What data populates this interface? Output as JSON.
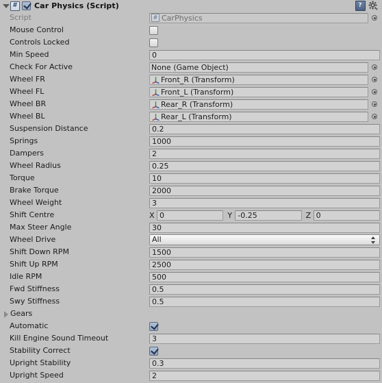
{
  "header": {
    "foldout": "expanded",
    "enabled_checkbox": true,
    "script_icon": "csharp-script-icon",
    "title": "Car Physics (Script)",
    "help_icon": "help-book-icon",
    "gear_icon": "gear-icon"
  },
  "rows": [
    {
      "label": "Script",
      "type": "object",
      "value": "CarPhysics",
      "icon": "csharp-script-icon",
      "disabled": true,
      "picker": true
    },
    {
      "label": "Mouse Control",
      "type": "checkbox",
      "checked": false
    },
    {
      "label": "Controls Locked",
      "type": "checkbox",
      "checked": false
    },
    {
      "label": "Min Speed",
      "type": "text",
      "value": "0"
    },
    {
      "label": "Check For Active",
      "type": "object",
      "value": "None (Game Object)",
      "icon": "none",
      "picker": true
    },
    {
      "label": "Wheel FR",
      "type": "object",
      "value": "Front_R (Transform)",
      "icon": "transform-icon",
      "picker": true
    },
    {
      "label": "Wheel FL",
      "type": "object",
      "value": "Front_L (Transform)",
      "icon": "transform-icon",
      "picker": true
    },
    {
      "label": "Wheel BR",
      "type": "object",
      "value": "Rear_R (Transform)",
      "icon": "transform-icon",
      "picker": true
    },
    {
      "label": "Wheel BL",
      "type": "object",
      "value": "Rear_L (Transform)",
      "icon": "transform-icon",
      "picker": true
    },
    {
      "label": "Suspension Distance",
      "type": "text",
      "value": "0.2"
    },
    {
      "label": "Springs",
      "type": "text",
      "value": "1000"
    },
    {
      "label": "Dampers",
      "type": "text",
      "value": "2"
    },
    {
      "label": "Wheel Radius",
      "type": "text",
      "value": "0.25"
    },
    {
      "label": "Torque",
      "type": "text",
      "value": "10"
    },
    {
      "label": "Brake Torque",
      "type": "text",
      "value": "2000"
    },
    {
      "label": "Wheel Weight",
      "type": "text",
      "value": "3"
    },
    {
      "label": "Shift Centre",
      "type": "vector3",
      "axes": [
        "X",
        "Y",
        "Z"
      ],
      "values": [
        "0",
        "-0.25",
        "0"
      ]
    },
    {
      "label": "Max Steer Angle",
      "type": "text",
      "value": "30"
    },
    {
      "label": "Wheel Drive",
      "type": "popup",
      "value": "All"
    },
    {
      "label": "Shift Down RPM",
      "type": "text",
      "value": "1500"
    },
    {
      "label": "Shift Up RPM",
      "type": "text",
      "value": "2500"
    },
    {
      "label": "Idle RPM",
      "type": "text",
      "value": "500"
    },
    {
      "label": "Fwd Stiffness",
      "type": "text",
      "value": "0.5"
    },
    {
      "label": "Swy Stiffness",
      "type": "text",
      "value": "0.5"
    },
    {
      "label": "Gears",
      "type": "foldout",
      "expanded": false
    },
    {
      "label": "Automatic",
      "type": "checkbox",
      "checked": true
    },
    {
      "label": "Kill Engine Sound Timeout",
      "type": "text",
      "value": "3"
    },
    {
      "label": "Stability Correct",
      "type": "checkbox",
      "checked": true
    },
    {
      "label": "Upright Stability",
      "type": "text",
      "value": "0.3"
    },
    {
      "label": "Upright Speed",
      "type": "text",
      "value": "2"
    }
  ],
  "colors": {
    "background": "#c2c2c2",
    "field_background": "#d2d2d2",
    "checkbox_on": "#9fb0c9",
    "text": "#1b1b1b",
    "disabled_text": "#7d7d7d"
  }
}
